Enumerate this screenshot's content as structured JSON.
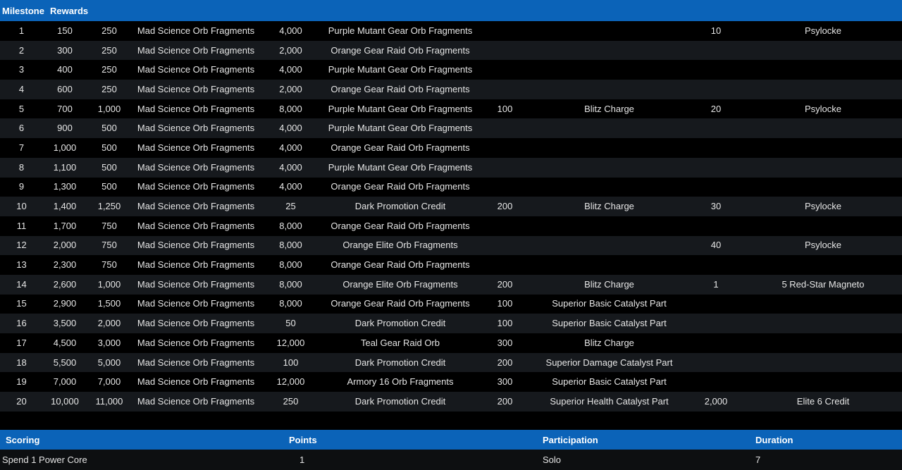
{
  "header": {
    "milestone": "Milestone",
    "rewards": "Rewards"
  },
  "rows": [
    [
      "1",
      "150",
      "250",
      "Mad Science Orb Fragments",
      "4,000",
      "Purple Mutant Gear Orb Fragments",
      "",
      "",
      "10",
      "Psylocke"
    ],
    [
      "2",
      "300",
      "250",
      "Mad Science Orb Fragments",
      "2,000",
      "Orange Gear Raid Orb Fragments",
      "",
      "",
      "",
      ""
    ],
    [
      "3",
      "400",
      "250",
      "Mad Science Orb Fragments",
      "4,000",
      "Purple Mutant Gear Orb Fragments",
      "",
      "",
      "",
      ""
    ],
    [
      "4",
      "600",
      "250",
      "Mad Science Orb Fragments",
      "2,000",
      "Orange Gear Raid Orb Fragments",
      "",
      "",
      "",
      ""
    ],
    [
      "5",
      "700",
      "1,000",
      "Mad Science Orb Fragments",
      "8,000",
      "Purple Mutant Gear Orb Fragments",
      "100",
      "Blitz Charge",
      "20",
      "Psylocke"
    ],
    [
      "6",
      "900",
      "500",
      "Mad Science Orb Fragments",
      "4,000",
      "Purple Mutant Gear Orb Fragments",
      "",
      "",
      "",
      ""
    ],
    [
      "7",
      "1,000",
      "500",
      "Mad Science Orb Fragments",
      "4,000",
      "Orange Gear Raid Orb Fragments",
      "",
      "",
      "",
      ""
    ],
    [
      "8",
      "1,100",
      "500",
      "Mad Science Orb Fragments",
      "4,000",
      "Purple Mutant Gear Orb Fragments",
      "",
      "",
      "",
      ""
    ],
    [
      "9",
      "1,300",
      "500",
      "Mad Science Orb Fragments",
      "4,000",
      "Orange Gear Raid Orb Fragments",
      "",
      "",
      "",
      ""
    ],
    [
      "10",
      "1,400",
      "1,250",
      "Mad Science Orb Fragments",
      "25",
      "Dark Promotion Credit",
      "200",
      "Blitz Charge",
      "30",
      "Psylocke"
    ],
    [
      "11",
      "1,700",
      "750",
      "Mad Science Orb Fragments",
      "8,000",
      "Orange Gear Raid Orb Fragments",
      "",
      "",
      "",
      ""
    ],
    [
      "12",
      "2,000",
      "750",
      "Mad Science Orb Fragments",
      "8,000",
      "Orange Elite Orb Fragments",
      "",
      "",
      "40",
      "Psylocke"
    ],
    [
      "13",
      "2,300",
      "750",
      "Mad Science Orb Fragments",
      "8,000",
      "Orange Gear Raid Orb Fragments",
      "",
      "",
      "",
      ""
    ],
    [
      "14",
      "2,600",
      "1,000",
      "Mad Science Orb Fragments",
      "8,000",
      "Orange Elite Orb Fragments",
      "200",
      "Blitz Charge",
      "1",
      "5 Red-Star Magneto"
    ],
    [
      "15",
      "2,900",
      "1,500",
      "Mad Science Orb Fragments",
      "8,000",
      "Orange Gear Raid Orb Fragments",
      "100",
      "Superior Basic Catalyst Part",
      "",
      ""
    ],
    [
      "16",
      "3,500",
      "2,000",
      "Mad Science Orb Fragments",
      "50",
      "Dark Promotion Credit",
      "100",
      "Superior Basic Catalyst Part",
      "",
      ""
    ],
    [
      "17",
      "4,500",
      "3,000",
      "Mad Science Orb Fragments",
      "12,000",
      "Teal Gear Raid Orb",
      "300",
      "Blitz Charge",
      "",
      ""
    ],
    [
      "18",
      "5,500",
      "5,000",
      "Mad Science Orb Fragments",
      "100",
      "Dark Promotion Credit",
      "200",
      "Superior Damage Catalyst Part",
      "",
      ""
    ],
    [
      "19",
      "7,000",
      "7,000",
      "Mad Science Orb Fragments",
      "12,000",
      "Armory 16 Orb Fragments",
      "300",
      "Superior Basic Catalyst Part",
      "",
      ""
    ],
    [
      "20",
      "10,000",
      "11,000",
      "Mad Science Orb Fragments",
      "250",
      "Dark Promotion Credit",
      "200",
      "Superior Health Catalyst Part",
      "2,000",
      "Elite 6 Credit"
    ]
  ],
  "scoring": {
    "headers": {
      "scoring": "Scoring",
      "points": "Points",
      "participation": "Participation",
      "duration": "Duration"
    },
    "row": {
      "scoring": "Spend 1 Power Core",
      "points": "1",
      "participation": "Solo",
      "duration": "7"
    }
  },
  "colors": {
    "header_bg": "#0b63b8",
    "row_alt_bg": "#16191d",
    "row_bg": "#000000",
    "text": "#e6e6e6"
  }
}
